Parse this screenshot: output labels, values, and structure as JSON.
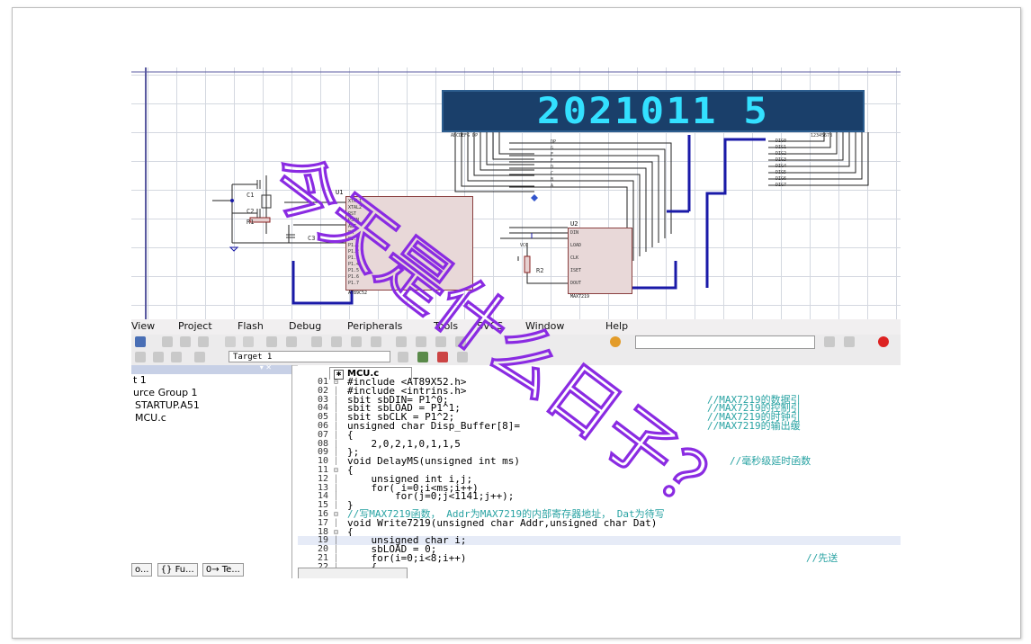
{
  "display": {
    "digits": "2021011 5"
  },
  "schematic": {
    "u1_label": "U1",
    "u2_label": "U2",
    "c1_label": "C1",
    "c2_label": "C2",
    "c3_label": "C3",
    "r1_label": "R1",
    "r2_label": "R2",
    "vcc_label": "VCC",
    "u1_part": "AT89C52",
    "u2_part": "MAX7219",
    "u1_pins_left": [
      "XTAL1",
      "XTAL2",
      "RST",
      "PSEN",
      "ALE",
      "EA",
      "P1.0",
      "P1.1",
      "P1.2",
      "P1.3",
      "P1.4",
      "P1.5",
      "P1.6",
      "P1.7"
    ],
    "u2_pins_left": [
      "DIN",
      "LOAD",
      "CLK",
      "ISET",
      "DOUT"
    ],
    "seg_labels": [
      "DP",
      "G",
      "F",
      "E",
      "D",
      "C",
      "B",
      "A"
    ],
    "dig_labels": [
      "DIG0",
      "DIG1",
      "DIG2",
      "DIG3",
      "DIG4",
      "DIG5",
      "DIG6",
      "DIG7"
    ]
  },
  "menu": [
    "View",
    "Project",
    "Flash",
    "Debug",
    "Peripherals",
    "Tools",
    "SVCS",
    "Window",
    "Help"
  ],
  "toolbar": {
    "target": "Target 1"
  },
  "project_pane": {
    "items": [
      "t 1",
      "urce Group 1",
      "STARTUP.A51",
      "MCU.c"
    ],
    "tabs": [
      "o...",
      "{} Fu...",
      "0→ Te..."
    ]
  },
  "editor": {
    "tab": "MCU.c",
    "lines": [
      {
        "n": "01",
        "code": "#include <AT89X52.h>",
        "comment": ""
      },
      {
        "n": "02",
        "code": "#include <intrins.h>",
        "comment": ""
      },
      {
        "n": "03",
        "code": "sbit sbDIN= P1^0;",
        "comment": "//MAX7219的数据引"
      },
      {
        "n": "04",
        "code": "sbit sbLOAD = P1^1;",
        "comment": "//MAX7219的控制引"
      },
      {
        "n": "05",
        "code": "sbit sbCLK = P1^2;",
        "comment": "//MAX7219的时钟引"
      },
      {
        "n": "06",
        "code": "unsigned char Disp_Buffer[8]=",
        "comment": "//MAX7219的输出缓"
      },
      {
        "n": "07",
        "code": "{",
        "comment": ""
      },
      {
        "n": "08",
        "code": "    2,0,2,1,0,1,1,5",
        "comment": ""
      },
      {
        "n": "09",
        "code": "};",
        "comment": ""
      },
      {
        "n": "10",
        "code": "void DelayMS(unsigned int ms)",
        "comment": "//毫秒级延时函数"
      },
      {
        "n": "11",
        "code": "{",
        "comment": ""
      },
      {
        "n": "12",
        "code": "    unsigned int i,j;",
        "comment": ""
      },
      {
        "n": "13",
        "code": "    for( i=0;i<ms;i++)",
        "comment": ""
      },
      {
        "n": "14",
        "code": "        for(j=0;j<1141;j++);",
        "comment": ""
      },
      {
        "n": "15",
        "code": "}",
        "comment": ""
      },
      {
        "n": "16",
        "code": "",
        "comment": "//写MAX7219函数， Addr为MAX7219的内部寄存器地址， Dat为待写"
      },
      {
        "n": "17",
        "code": "void Write7219(unsigned char Addr,unsigned char Dat)",
        "comment": ""
      },
      {
        "n": "18",
        "code": "{",
        "comment": ""
      },
      {
        "n": "19",
        "code": "    unsigned char i;",
        "comment": ""
      },
      {
        "n": "20",
        "code": "    sbLOAD = 0;",
        "comment": ""
      },
      {
        "n": "21",
        "code": "    for(i=0;i<8;i++)",
        "comment": "//先送"
      },
      {
        "n": "22",
        "code": "    {",
        "comment": ""
      }
    ]
  },
  "overlay_text": "今天是什么日子？",
  "colors": {
    "overlay": "#8a2be2",
    "display_bg": "#1a3f6a",
    "digit": "#33e0ff",
    "wire": "#1a1aa8",
    "comment": "#29a3a3"
  }
}
